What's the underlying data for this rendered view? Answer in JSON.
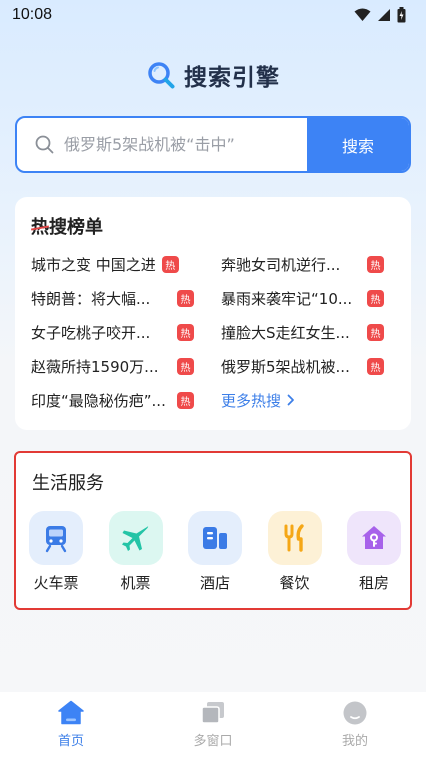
{
  "status_bar": {
    "time": "10:08",
    "icons": [
      "wifi-icon",
      "signal-icon",
      "battery-charging-icon"
    ]
  },
  "header": {
    "logo_icon": "search-icon",
    "title": "搜索引擎"
  },
  "search": {
    "placeholder": "俄罗斯5架战机被“击中”",
    "value": "",
    "button_label": "搜索"
  },
  "hot": {
    "title_strike": "热",
    "title_rest": "搜榜单",
    "badge_label": "热",
    "items": [
      "城市之变 中国之进",
      "奔驰女司机逆行...",
      "特朗普：将大幅...",
      "暴雨来袭牢记“10...",
      "女子吃桃子咬开...",
      "撞脸大S走红女生...",
      "赵薇所持1590万...",
      "俄罗斯5架战机被...",
      "印度“最隐秘伤疤”..."
    ],
    "more_label": "更多热搜"
  },
  "life": {
    "title": "生活服务",
    "services": [
      {
        "label": "火车票",
        "icon": "train-icon",
        "bg": "#e4eefc",
        "color": "#3b7be6"
      },
      {
        "label": "机票",
        "icon": "airplane-icon",
        "bg": "#dcf7f1",
        "color": "#23c4a6"
      },
      {
        "label": "酒店",
        "icon": "hotel-icon",
        "bg": "#e4eefc",
        "color": "#3b7be6"
      },
      {
        "label": "餐饮",
        "icon": "fork-knife-icon",
        "bg": "#fdf1d6",
        "color": "#f5a716"
      },
      {
        "label": "租房",
        "icon": "house-key-icon",
        "bg": "#efe5fb",
        "color": "#a762ea"
      }
    ]
  },
  "nav": {
    "items": [
      {
        "label": "首页",
        "icon": "home-icon",
        "active": true
      },
      {
        "label": "多窗口",
        "icon": "windows-icon",
        "active": false
      },
      {
        "label": "我的",
        "icon": "profile-icon",
        "active": false
      }
    ]
  },
  "colors": {
    "accent": "#3d83f5",
    "hot_badge": "#ef4a4a",
    "highlight_border": "#e23a35",
    "link": "#3d7fe8"
  }
}
